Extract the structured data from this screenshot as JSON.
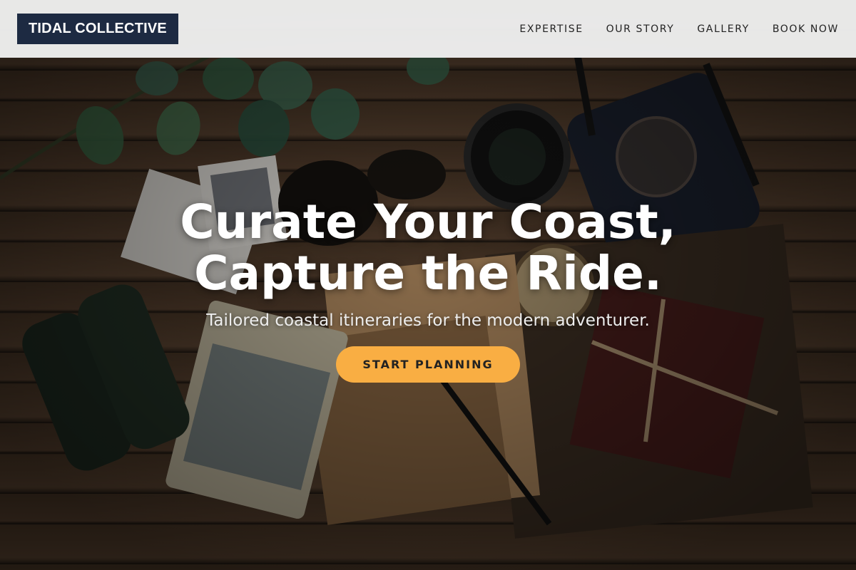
{
  "brand": {
    "logo_text": "TIDAL COLLECTIVE"
  },
  "nav": {
    "items": [
      {
        "label": "EXPERTISE"
      },
      {
        "label": "OUR STORY"
      },
      {
        "label": "GALLERY"
      },
      {
        "label": "BOOK NOW"
      }
    ]
  },
  "hero": {
    "headline_line1": "Curate Your Coast,",
    "headline_line2": "Capture the Ride.",
    "subheadline": "Tailored coastal itineraries for the modern adventurer.",
    "cta_label": "START PLANNING"
  },
  "colors": {
    "logo_bg": "#1d2a42",
    "cta_bg": "#f9ae43",
    "navbar_bg": "#f0f0f0"
  }
}
